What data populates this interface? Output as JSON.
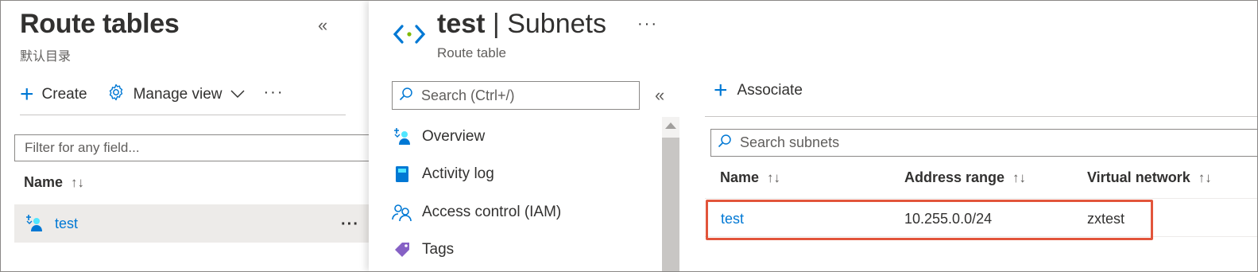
{
  "left": {
    "title": "Route tables",
    "subtitle": "默认目录",
    "collapse_glyph": "«",
    "toolbar": {
      "create_label": "Create",
      "manage_view_label": "Manage view",
      "more_glyph": "···"
    },
    "filter_placeholder": "Filter for any field...",
    "column_header": "Name",
    "sort_glyph": "↑↓",
    "rows": [
      {
        "name": "test",
        "more_glyph": "···"
      }
    ]
  },
  "right": {
    "title_bold": "test",
    "title_rest": " | Subnets",
    "subtitle": "Route table",
    "more_glyph": "···",
    "menu": {
      "search_placeholder": "Search (Ctrl+/)",
      "collapse_glyph": "«",
      "items": [
        {
          "label": "Overview",
          "icon": "route-table-icon"
        },
        {
          "label": "Activity log",
          "icon": "activity-log-icon"
        },
        {
          "label": "Access control (IAM)",
          "icon": "iam-icon"
        },
        {
          "label": "Tags",
          "icon": "tag-icon"
        }
      ]
    },
    "associate_label": "Associate",
    "subnet_search_placeholder": "Search subnets",
    "columns": [
      "Name",
      "Address range",
      "Virtual network"
    ],
    "sort_glyph": "↑↓",
    "subnets": [
      {
        "name": "test",
        "address_range": "10.255.0.0/24",
        "virtual_network": "zxtest"
      }
    ]
  },
  "colors": {
    "accent": "#0078d4",
    "highlight": "#e2553b",
    "selected_row": "#edebe9"
  }
}
